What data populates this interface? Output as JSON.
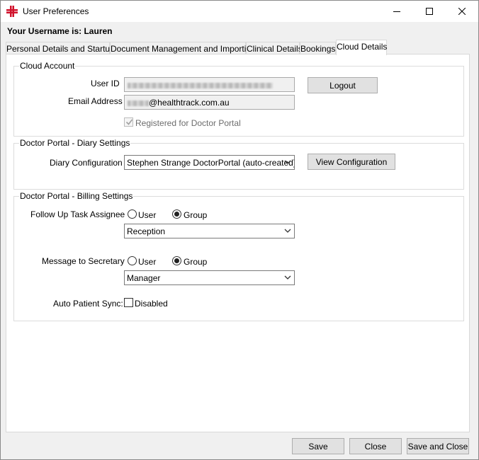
{
  "window": {
    "title": "User Preferences"
  },
  "header": {
    "username_label": "Your Username is: Lauren"
  },
  "tabs": [
    {
      "label": "Personal Details and Startup",
      "active": false
    },
    {
      "label": "Document Management and Importing",
      "active": false
    },
    {
      "label": "Clinical Details",
      "active": false
    },
    {
      "label": "Bookings",
      "active": false
    },
    {
      "label": "Cloud Details",
      "active": true
    }
  ],
  "cloud_account": {
    "title": "Cloud Account",
    "user_id_label": "User ID",
    "user_id_value": "",
    "email_label": "Email Address",
    "email_value": "@healthtrack.com.au",
    "logout_label": "Logout",
    "registered_label": "Registered for Doctor Portal",
    "registered_checked": true
  },
  "diary_settings": {
    "title": "Doctor Portal - Diary Settings",
    "config_label": "Diary Configuration",
    "config_value": "Stephen Strange DoctorPortal (auto-created)",
    "view_config_label": "View Configuration"
  },
  "billing_settings": {
    "title": "Doctor Portal - Billing Settings",
    "followup_label": "Follow Up Task Assignee",
    "followup_user_label": "User",
    "followup_group_label": "Group",
    "followup_selected": "Group",
    "followup_select_value": "Reception",
    "message_label": "Message to Secretary",
    "message_user_label": "User",
    "message_group_label": "Group",
    "message_selected": "Group",
    "message_select_value": "Manager",
    "sync_label": "Auto Patient Sync:",
    "sync_checkbox_label": "Disabled",
    "sync_checked": false
  },
  "footer": {
    "save_label": "Save",
    "close_label": "Close",
    "save_close_label": "Save and Close"
  }
}
